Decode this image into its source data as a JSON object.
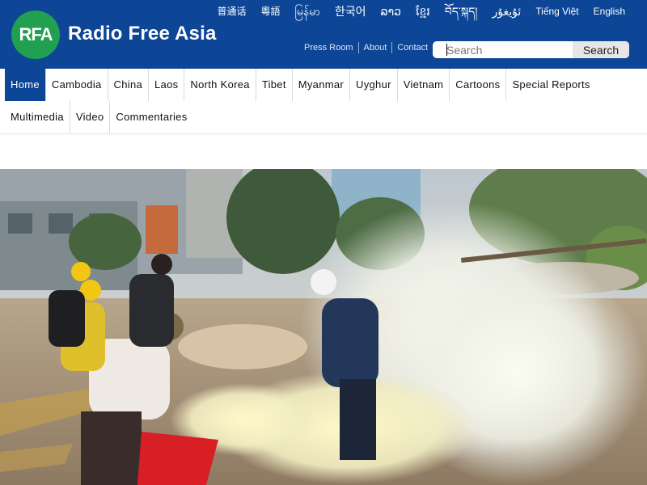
{
  "header": {
    "logo_text": "RFA",
    "brand": "Radio Free Asia",
    "languages": [
      {
        "label": "普通话"
      },
      {
        "label": "粵語"
      },
      {
        "label": "မြန်မာ"
      },
      {
        "label": "한국어"
      },
      {
        "label": "ລາວ"
      },
      {
        "label": "ខ្មែរ"
      },
      {
        "label": "བོད་སྐད།"
      },
      {
        "label": "ئۇيغۇر"
      },
      {
        "label": "Tiếng Việt"
      },
      {
        "label": "English"
      }
    ],
    "utility_links": [
      "Press Room",
      "About",
      "Contact"
    ],
    "search": {
      "placeholder": "Search",
      "button": "Search"
    }
  },
  "nav": {
    "row1": [
      "Home",
      "Cambodia",
      "China",
      "Laos",
      "North Korea",
      "Tibet",
      "Myanmar",
      "Uyghur",
      "Vietnam",
      "Cartoons",
      "Special Reports"
    ],
    "row2": [
      "Multimedia",
      "Video",
      "Commentaries"
    ],
    "active": "Home"
  },
  "colors": {
    "header_bg": "#0d4597",
    "logo_green": "#22a051",
    "active_nav": "#0d4597"
  },
  "hero": {
    "image": "street-protest-tear-gas-photo"
  }
}
